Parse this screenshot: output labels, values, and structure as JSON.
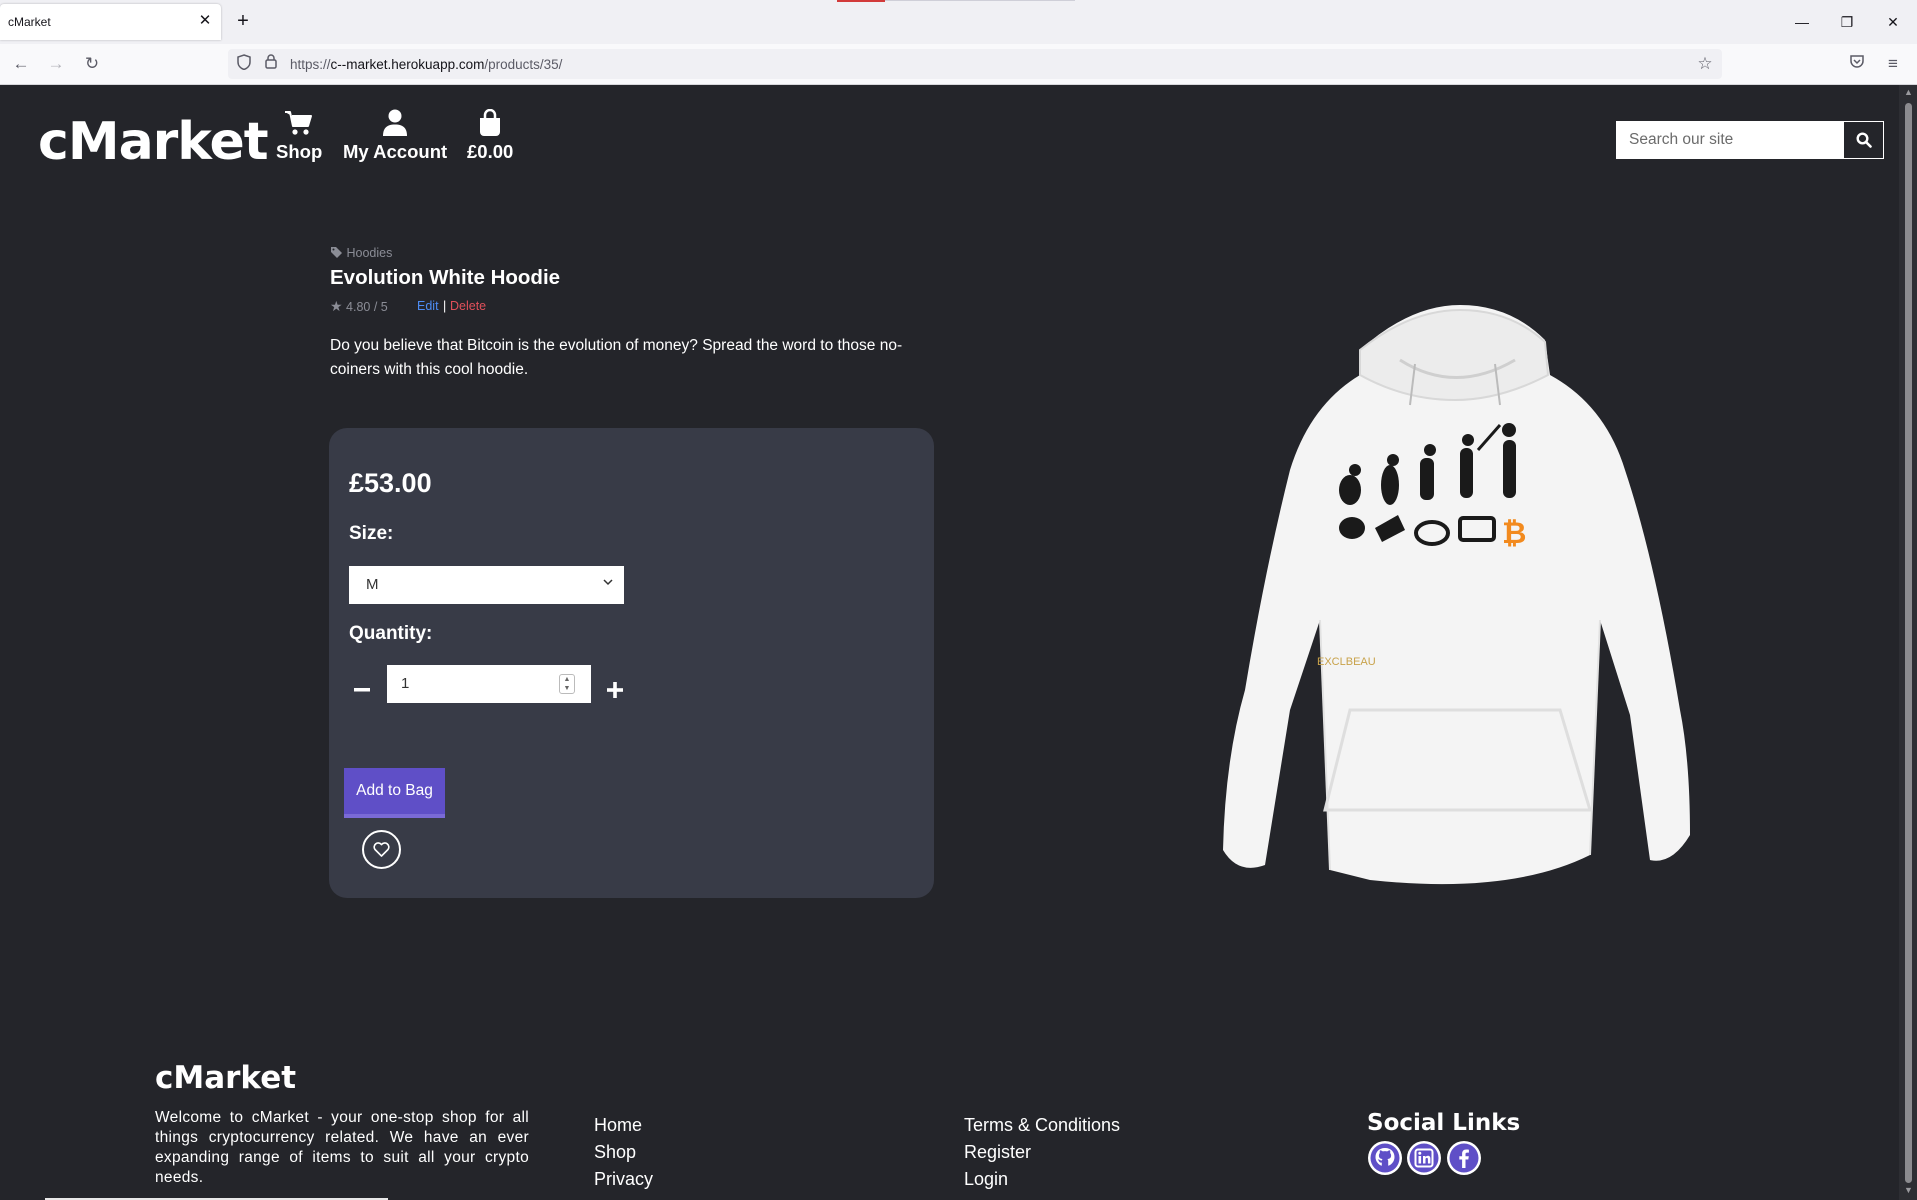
{
  "browser": {
    "tab_title": "cMarket",
    "url_prefix": "https://",
    "url_host": "c--market.herokuapp.com",
    "url_path": "/products/35/"
  },
  "header": {
    "logo": "cMarket",
    "nav": [
      {
        "label": "Shop",
        "icon": "cart-icon"
      },
      {
        "label": "My Account",
        "icon": "user-icon"
      },
      {
        "label": "£0.00",
        "icon": "shopping-bag-icon"
      }
    ],
    "search_placeholder": "Search our site"
  },
  "product": {
    "category": "Hoodies",
    "title": "Evolution White Hoodie",
    "rating": "4.80 / 5",
    "edit_label": "Edit",
    "separator": "|",
    "delete_label": "Delete",
    "description": "Do you believe that Bitcoin is the evolution of money? Spread the word to those no-coiners with this cool hoodie.",
    "price": "£53.00",
    "size_label": "Size:",
    "size_value": "M",
    "quantity_label": "Quantity:",
    "quantity_value": "1",
    "add_button": "Add to Bag",
    "hoodie_tag": "EXCLBEAU"
  },
  "footer": {
    "logo": "cMarket",
    "description": "Welcome to cMarket - your one-stop shop for all things cryptocurrency related. We have an ever expanding range of items to suit all your crypto needs.",
    "links_col1": [
      "Home",
      "Shop",
      "Privacy"
    ],
    "links_col2": [
      "Terms & Conditions",
      "Register",
      "Login"
    ],
    "social_title": "Social Links",
    "social_icons": [
      "github-icon",
      "linkedin-icon",
      "facebook-icon"
    ]
  },
  "colors": {
    "background": "#24252a",
    "card": "#383b47",
    "accent": "#5f4fc7",
    "edit_link": "#4d8cf5",
    "delete_link": "#e0505a"
  }
}
